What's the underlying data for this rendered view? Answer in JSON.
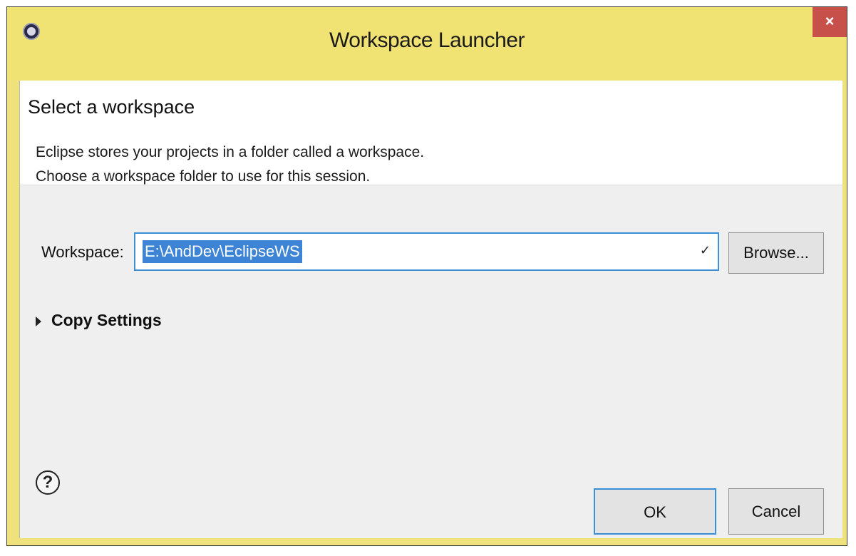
{
  "window": {
    "title": "Workspace Launcher",
    "close_icon": "×"
  },
  "header": {
    "title": "Select a workspace",
    "description_line1": "Eclipse stores your projects in a folder called a workspace.",
    "description_line2": "Choose a workspace folder to use for this session."
  },
  "workspace": {
    "label": "Workspace:",
    "value": "E:\\AndDev\\EclipseWS",
    "dropdown_icon": "dropdown-arrow-icon"
  },
  "buttons": {
    "browse": "Browse...",
    "ok": "OK",
    "cancel": "Cancel"
  },
  "copy_settings": {
    "label": "Copy Settings"
  },
  "help": {
    "icon": "help-icon",
    "symbol": "?"
  },
  "colors": {
    "titlebar": "#f0e273",
    "close_button": "#c7504b",
    "selection": "#3d84d6",
    "focus_border": "#3b8fd8"
  }
}
